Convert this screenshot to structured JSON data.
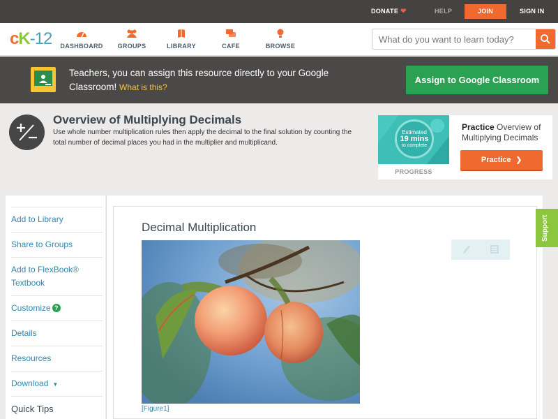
{
  "topbar": {
    "donate": "DONATE",
    "help": "HELP",
    "join": "JOIN",
    "signin": "SIGN IN"
  },
  "nav": {
    "logo": {
      "c": "c",
      "k": "K",
      "n": "-12"
    },
    "items": [
      {
        "label": "DASHBOARD",
        "icon": "dashboard-icon"
      },
      {
        "label": "GROUPS",
        "icon": "groups-icon"
      },
      {
        "label": "LIBRARY",
        "icon": "library-icon"
      },
      {
        "label": "CAFE",
        "icon": "cafe-icon"
      },
      {
        "label": "BROWSE",
        "icon": "browse-icon"
      }
    ],
    "search_placeholder": "What do you want to learn today?"
  },
  "banner": {
    "text": "Teachers, you can assign this resource directly to your Google Classroom!",
    "what_is_this": "What is this?",
    "assign_button": "Assign to Google Classroom"
  },
  "concept": {
    "title": "Overview of Multiplying Decimals",
    "description": "Use whole number multiplication rules then apply the decimal to the final solution by counting the total number of decimal places you had in the multiplier and multiplicand."
  },
  "practice": {
    "estimated": "Estimated",
    "minutes": "19 mins",
    "to_complete": "to complete",
    "progress_label": "PROGRESS",
    "prefix": "Practice",
    "title": "Overview of Multiplying Decimals",
    "button": "Practice"
  },
  "sidebar": {
    "items": [
      {
        "label": "Add to Library"
      },
      {
        "label": "Share to Groups"
      },
      {
        "label": "Add to FlexBook® Textbook"
      },
      {
        "label": "Customize"
      },
      {
        "label": "Details"
      },
      {
        "label": "Resources"
      },
      {
        "label": "Download"
      }
    ],
    "quick_tips": "Quick Tips"
  },
  "main": {
    "heading": "Decimal Multiplication",
    "figure_caption": "[Figure1]"
  },
  "support": "Support",
  "colors": {
    "brand_orange": "#f06a2f",
    "brand_green": "#8cc63e",
    "google_green": "#2ba152",
    "link_blue": "#2b8ab0",
    "teal": "#3dbfb8"
  }
}
